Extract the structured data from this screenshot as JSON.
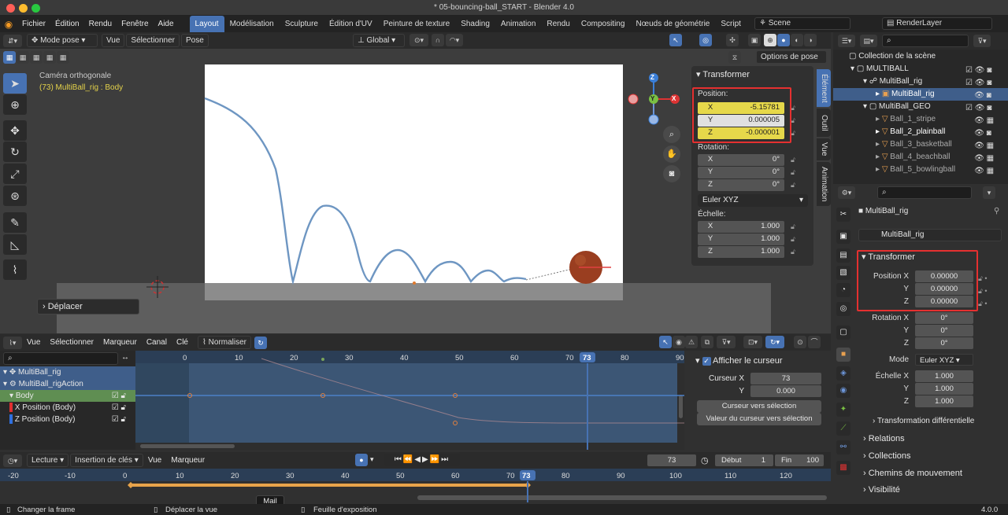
{
  "window": {
    "title": "* 05-bouncing-ball_START - Blender 4.0"
  },
  "menu": [
    "Fichier",
    "Édition",
    "Rendu",
    "Fenêtre",
    "Aide"
  ],
  "workspaces": [
    "Layout",
    "Modélisation",
    "Sculpture",
    "Édition d'UV",
    "Peinture de texture",
    "Shading",
    "Animation",
    "Rendu",
    "Compositing",
    "Nœuds de géométrie",
    "Script"
  ],
  "scene": {
    "name": "Scene",
    "render_layer": "RenderLayer"
  },
  "viewport": {
    "mode": "Mode pose",
    "menus": [
      "Vue",
      "Sélectionner",
      "Pose"
    ],
    "orientation": "Global",
    "camera_label": "Caméra orthogonale",
    "object_label": "(73) MultiBall_rig : Body",
    "pose_options": "Options de pose",
    "operator_panel": "Déplacer",
    "gizmo_axes": [
      "Z",
      "Y",
      "X"
    ]
  },
  "npanel": {
    "title": "Transformer",
    "position_label": "Position:",
    "position": [
      {
        "k": "X",
        "v": "-5.15781"
      },
      {
        "k": "Y",
        "v": "0.000005"
      },
      {
        "k": "Z",
        "v": "-0.000001"
      }
    ],
    "rotation_label": "Rotation:",
    "rotation": [
      {
        "k": "X",
        "v": "0°"
      },
      {
        "k": "Y",
        "v": "0°"
      },
      {
        "k": "Z",
        "v": "0°"
      }
    ],
    "rotation_mode": "Euler XYZ",
    "scale_label": "Échelle:",
    "scale": [
      {
        "k": "X",
        "v": "1.000"
      },
      {
        "k": "Y",
        "v": "1.000"
      },
      {
        "k": "Z",
        "v": "1.000"
      }
    ],
    "tabs": [
      "Élément",
      "Outil",
      "Vue",
      "Animation"
    ]
  },
  "outliner": {
    "root": "Collection de la scène",
    "items": [
      {
        "name": "MULTIBALL",
        "level": 0,
        "selected": false
      },
      {
        "name": "MultiBall_rig",
        "level": 1,
        "selected": false
      },
      {
        "name": "MultiBall_rig",
        "level": 2,
        "selected": true
      },
      {
        "name": "MultiBall_GEO",
        "level": 1,
        "selected": false
      },
      {
        "name": "Ball_1_stripe",
        "level": 2,
        "selected": false
      },
      {
        "name": "Ball_2_plainball",
        "level": 2,
        "selected": false
      },
      {
        "name": "Ball_3_basketball",
        "level": 2,
        "selected": false
      },
      {
        "name": "Ball_4_beachball",
        "level": 2,
        "selected": false
      },
      {
        "name": "Ball_5_bowlingball",
        "level": 2,
        "selected": false
      }
    ]
  },
  "properties": {
    "object_name": "MultiBall_rig",
    "data_name": "MultiBall_rig",
    "transform_title": "Transformer",
    "position": [
      {
        "k": "Position X",
        "v": "0.00000"
      },
      {
        "k": "Y",
        "v": "0.00000"
      },
      {
        "k": "Z",
        "v": "0.00000"
      }
    ],
    "rotation": [
      {
        "k": "Rotation X",
        "v": "0°"
      },
      {
        "k": "Y",
        "v": "0°"
      },
      {
        "k": "Z",
        "v": "0°"
      }
    ],
    "mode_label": "Mode",
    "mode_value": "Euler XYZ",
    "scale": [
      {
        "k": "Échelle X",
        "v": "1.000"
      },
      {
        "k": "Y",
        "v": "1.000"
      },
      {
        "k": "Z",
        "v": "1.000"
      }
    ],
    "delta": "Transformation différentielle",
    "sections": [
      "Relations",
      "Collections",
      "Chemins de mouvement",
      "Visibilité"
    ]
  },
  "graph": {
    "menus": [
      "Vue",
      "Sélectionner",
      "Marqueur",
      "Canal",
      "Clé"
    ],
    "normalize": "Normaliser",
    "channels": [
      {
        "name": "MultiBall_rig",
        "type": "object"
      },
      {
        "name": "MultiBall_rigAction",
        "type": "action"
      },
      {
        "name": "Body",
        "type": "group"
      },
      {
        "name": "X Position (Body)",
        "type": "curve",
        "color": "#e03030"
      },
      {
        "name": "Z Position (Body)",
        "type": "curve",
        "color": "#3070e0"
      }
    ],
    "ruler": [
      "0",
      "10",
      "20",
      "30",
      "40",
      "50",
      "60",
      "70",
      "73",
      "80",
      "90"
    ],
    "cursor_panel": {
      "show_cursor": "Afficher le curseur",
      "cursor_x_label": "Curseur X",
      "cursor_x": "73",
      "y_label": "Y",
      "y_value": "0.000",
      "btn1": "Curseur vers sélection",
      "btn2": "Valeur du curseur vers sélection"
    }
  },
  "timeline": {
    "menus": [
      "Lecture",
      "Insertion de clés",
      "Vue",
      "Marqueur"
    ],
    "current_frame": "73",
    "start_label": "Début",
    "start": "1",
    "end_label": "Fin",
    "end": "100",
    "ruler": [
      "-20",
      "-10",
      "0",
      "10",
      "20",
      "30",
      "40",
      "50",
      "60",
      "70",
      "73",
      "80",
      "90",
      "100",
      "110",
      "120"
    ]
  },
  "status": {
    "items": [
      "Changer la frame",
      "Déplacer la vue",
      "Feuille d'exposition"
    ],
    "tooltip": "Mail",
    "version": "4.0.0"
  }
}
